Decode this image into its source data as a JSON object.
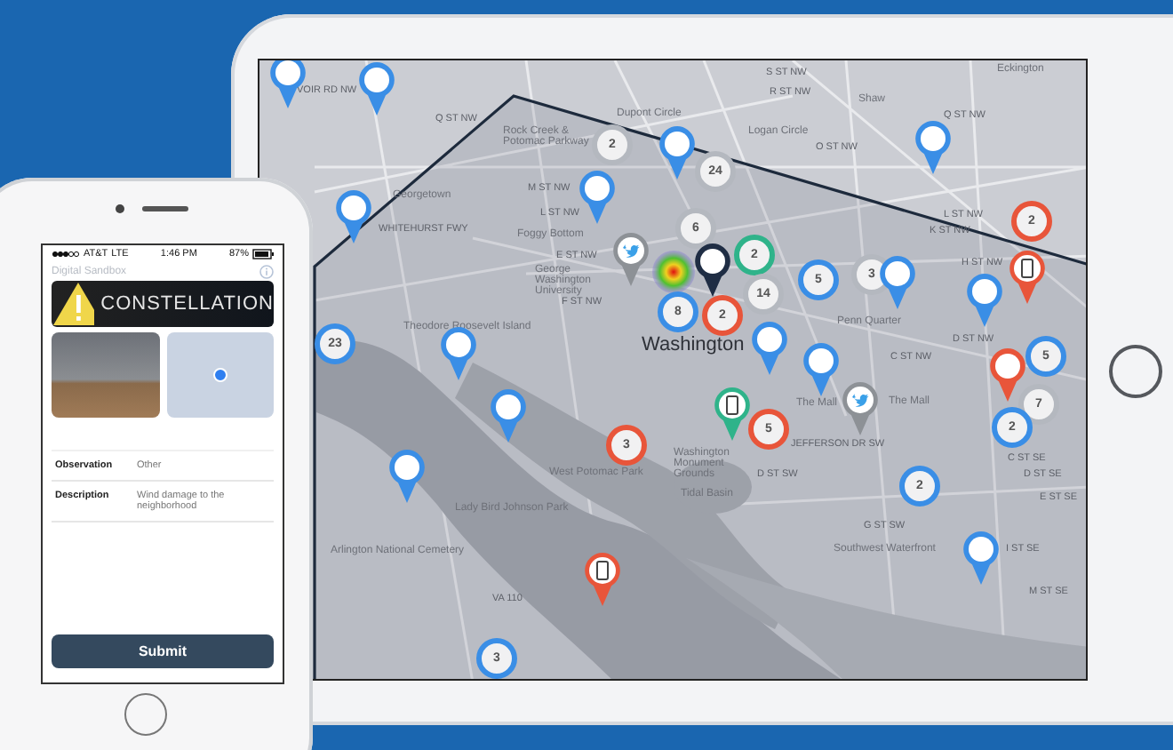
{
  "phone": {
    "status_bar": {
      "carrier": "AT&T",
      "network": "LTE",
      "time": "1:46 PM",
      "battery": "87%"
    },
    "app_title": "Digital Sandbox",
    "banner": {
      "title": "CONSTELLATION"
    },
    "fields": [
      {
        "label": "Observation",
        "value": "Other"
      },
      {
        "label": "Description",
        "value": "Wind damage to the neighborhood"
      }
    ],
    "submit_button": "Submit"
  },
  "map": {
    "labels": [
      {
        "text": "VOIR RD NW",
        "kind": "street"
      },
      {
        "text": "Q ST NW",
        "kind": "street"
      },
      {
        "text": "Rock Creek & Potomac Parkway",
        "kind": "place"
      },
      {
        "text": "Dupont Circle",
        "kind": "place"
      },
      {
        "text": "S ST NW",
        "kind": "street"
      },
      {
        "text": "R ST NW",
        "kind": "street"
      },
      {
        "text": "Shaw",
        "kind": "place"
      },
      {
        "text": "Eckington",
        "kind": "place"
      },
      {
        "text": "Logan Circle",
        "kind": "place"
      },
      {
        "text": "Q ST NW",
        "kind": "street"
      },
      {
        "text": "O ST NW",
        "kind": "street"
      },
      {
        "text": "Georgetown",
        "kind": "place"
      },
      {
        "text": "WHITEHURST FWY",
        "kind": "street"
      },
      {
        "text": "M ST NW",
        "kind": "street"
      },
      {
        "text": "L ST NW",
        "kind": "street"
      },
      {
        "text": "Foggy Bottom",
        "kind": "place"
      },
      {
        "text": "L ST NW",
        "kind": "street"
      },
      {
        "text": "K ST NW",
        "kind": "street"
      },
      {
        "text": "E ST NW",
        "kind": "street"
      },
      {
        "text": "George Washington University",
        "kind": "place"
      },
      {
        "text": "H ST NW",
        "kind": "street"
      },
      {
        "text": "F ST NW",
        "kind": "street"
      },
      {
        "text": "Penn Quarter",
        "kind": "place"
      },
      {
        "text": "Theodore Roosevelt Island",
        "kind": "place"
      },
      {
        "text": "Washington",
        "kind": "city"
      },
      {
        "text": "D ST NW",
        "kind": "street"
      },
      {
        "text": "C ST NW",
        "kind": "street"
      },
      {
        "text": "The Mall",
        "kind": "place"
      },
      {
        "text": "The Mall",
        "kind": "place"
      },
      {
        "text": "JEFFERSON DR SW",
        "kind": "street"
      },
      {
        "text": "West Potomac Park",
        "kind": "place"
      },
      {
        "text": "Washington Monument Grounds",
        "kind": "place"
      },
      {
        "text": "C ST SE",
        "kind": "street"
      },
      {
        "text": "D ST SW",
        "kind": "street"
      },
      {
        "text": "D ST SE",
        "kind": "street"
      },
      {
        "text": "Tidal Basin",
        "kind": "place"
      },
      {
        "text": "E ST SE",
        "kind": "street"
      },
      {
        "text": "Lady Bird Johnson Park",
        "kind": "place"
      },
      {
        "text": "G ST SW",
        "kind": "street"
      },
      {
        "text": "Arlington National Cemetery",
        "kind": "place"
      },
      {
        "text": "Southwest Waterfront",
        "kind": "place"
      },
      {
        "text": "I ST SE",
        "kind": "street"
      },
      {
        "text": "M ST SE",
        "kind": "street"
      },
      {
        "text": "VA 110",
        "kind": "street"
      }
    ],
    "markers": [
      {
        "kind": "pin",
        "color": "#3a8ee6"
      },
      {
        "kind": "pin",
        "color": "#3a8ee6"
      },
      {
        "kind": "pin",
        "color": "#3a8ee6"
      },
      {
        "kind": "pin",
        "color": "#3a8ee6"
      },
      {
        "kind": "pin",
        "color": "#3a8ee6"
      },
      {
        "kind": "pin",
        "color": "#3a8ee6"
      },
      {
        "kind": "cluster",
        "count": "2",
        "color": "#b4b8bf"
      },
      {
        "kind": "cluster",
        "count": "24",
        "color": "#b4b8bf"
      },
      {
        "kind": "cluster",
        "count": "6",
        "color": "#b4b8bf"
      },
      {
        "kind": "twitter"
      },
      {
        "kind": "heat"
      },
      {
        "kind": "cluster",
        "count": "8",
        "color": "#3a8ee6"
      },
      {
        "kind": "cluster",
        "count": "2",
        "color": "#2fb38a"
      },
      {
        "kind": "cluster",
        "count": "14",
        "color": "#b4b8bf"
      },
      {
        "kind": "pin",
        "color": "#1f2d44"
      },
      {
        "kind": "cluster",
        "count": "2",
        "color": "#e8553a"
      },
      {
        "kind": "pin",
        "color": "#3a8ee6"
      },
      {
        "kind": "cluster",
        "count": "5",
        "color": "#3a8ee6"
      },
      {
        "kind": "cluster",
        "count": "3",
        "color": "#b4b8bf"
      },
      {
        "kind": "pin",
        "color": "#3a8ee6"
      },
      {
        "kind": "pin",
        "color": "#3a8ee6"
      },
      {
        "kind": "cluster",
        "count": "2",
        "color": "#e8553a"
      },
      {
        "kind": "device",
        "color": "#e8553a"
      },
      {
        "kind": "cluster",
        "count": "5",
        "color": "#3a8ee6"
      },
      {
        "kind": "pin",
        "color": "#e8553a"
      },
      {
        "kind": "cluster",
        "count": "7",
        "color": "#b4b8bf"
      },
      {
        "kind": "cluster",
        "count": "2",
        "color": "#3a8ee6"
      },
      {
        "kind": "pin",
        "color": "#3a8ee6"
      },
      {
        "kind": "twitter"
      },
      {
        "kind": "device",
        "color": "#2fb38a"
      },
      {
        "kind": "cluster",
        "count": "5",
        "color": "#e8553a"
      },
      {
        "kind": "cluster",
        "count": "3",
        "color": "#e8553a"
      },
      {
        "kind": "cluster",
        "count": "23",
        "color": "#3a8ee6"
      },
      {
        "kind": "pin",
        "color": "#3a8ee6"
      },
      {
        "kind": "pin",
        "color": "#3a8ee6"
      },
      {
        "kind": "pin",
        "color": "#3a8ee6"
      },
      {
        "kind": "device",
        "color": "#e8553a"
      },
      {
        "kind": "cluster",
        "count": "2",
        "color": "#3a8ee6"
      },
      {
        "kind": "pin",
        "color": "#3a8ee6"
      },
      {
        "kind": "cluster",
        "count": "3",
        "color": "#3a8ee6"
      }
    ]
  }
}
